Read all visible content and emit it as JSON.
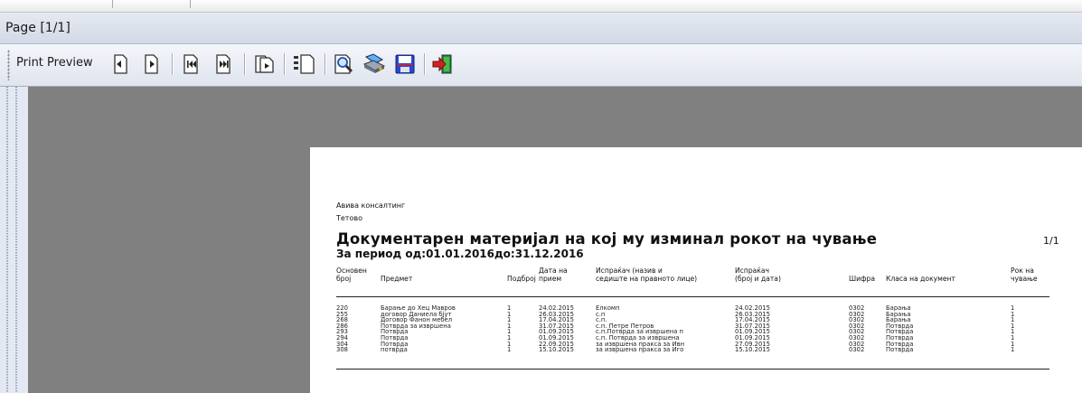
{
  "window": {
    "title": "Page [1/1]"
  },
  "toolbar": {
    "label": "Print Preview",
    "buttons": [
      {
        "name": "previous-page-button",
        "icon": "page-left-icon"
      },
      {
        "name": "next-page-button",
        "icon": "page-right-icon"
      },
      {
        "name": "first-page-button",
        "icon": "first-page-icon"
      },
      {
        "name": "last-page-button",
        "icon": "last-page-icon"
      },
      {
        "name": "refresh-button",
        "icon": "refresh-page-icon"
      },
      {
        "name": "page-setup-button",
        "icon": "page-setup-icon"
      },
      {
        "name": "zoom-button",
        "icon": "magnifier-icon"
      },
      {
        "name": "print-button",
        "icon": "printer-icon"
      },
      {
        "name": "save-button",
        "icon": "floppy-disk-icon"
      },
      {
        "name": "exit-button",
        "icon": "exit-arrow-icon"
      }
    ]
  },
  "report": {
    "company": "Авива консалтинг",
    "city": "Тетово",
    "title": "Документарен материјал на кој му изминал рокот на чување",
    "period": "За период од:01.01.2016до:31.12.2016",
    "page": "1/1",
    "columns": [
      {
        "line1": "Основен",
        "line2": "број"
      },
      {
        "line1": "",
        "line2": "Предмет"
      },
      {
        "line1": "",
        "line2": "Подброј"
      },
      {
        "line1": "Дата на",
        "line2": "прием"
      },
      {
        "line1": "Испраќач (назив и",
        "line2": "седиште на правното лице)"
      },
      {
        "line1": "Испраќач",
        "line2": "(број и дата)"
      },
      {
        "line1": "",
        "line2": "Шифра"
      },
      {
        "line1": "",
        "line2": "Класа на документ"
      },
      {
        "line1": "Рок на",
        "line2": "чување"
      }
    ],
    "rows": [
      [
        "220",
        "Барање до Хец Мавров",
        "1",
        "24.02.2015",
        "Елкомп",
        "24.02.2015",
        "0302",
        "Барања",
        "1"
      ],
      [
        "255",
        "договор Даниела бјут",
        "1",
        "26.03.2015",
        "с.п",
        "26.03.2015",
        "0302",
        "Барања",
        "1"
      ],
      [
        "268",
        "Договор Фанон мебел",
        "1",
        "17.04.2015",
        "с.п.",
        "17.04.2015",
        "0302",
        "Барања",
        "1"
      ],
      [
        "286",
        "Потврда за извршена",
        "1",
        "31.07.2015",
        "с.п. Петре Петров",
        "31.07.2015",
        "0302",
        "Потврда",
        "1"
      ],
      [
        "293",
        "Потврда",
        "1",
        "01.09.2015",
        "с.п.Потврда за извршена п",
        "01.09.2015",
        "0302",
        "Потврда",
        "1"
      ],
      [
        "294",
        "Потврда",
        "1",
        "01.09.2015",
        "с.п. Потврда за извршена",
        "01.09.2015",
        "0302",
        "Потврда",
        "1"
      ],
      [
        "304",
        "Потврда",
        "1",
        "22.09.2015",
        "за извршена пракса за Ивн",
        "27.09.2015",
        "0302",
        "Потврда",
        "1"
      ],
      [
        "308",
        "потврда",
        "1",
        "15.10.2015",
        "за извршена пракса за Иго",
        "15.10.2015",
        "0302",
        "Потврда",
        "1"
      ]
    ]
  },
  "colors": {
    "canvas": "#808080",
    "paper": "#ffffff",
    "toolbar": "#e3e8f2",
    "accent_exit": "#d02020",
    "accent_save": "#2040c0"
  }
}
